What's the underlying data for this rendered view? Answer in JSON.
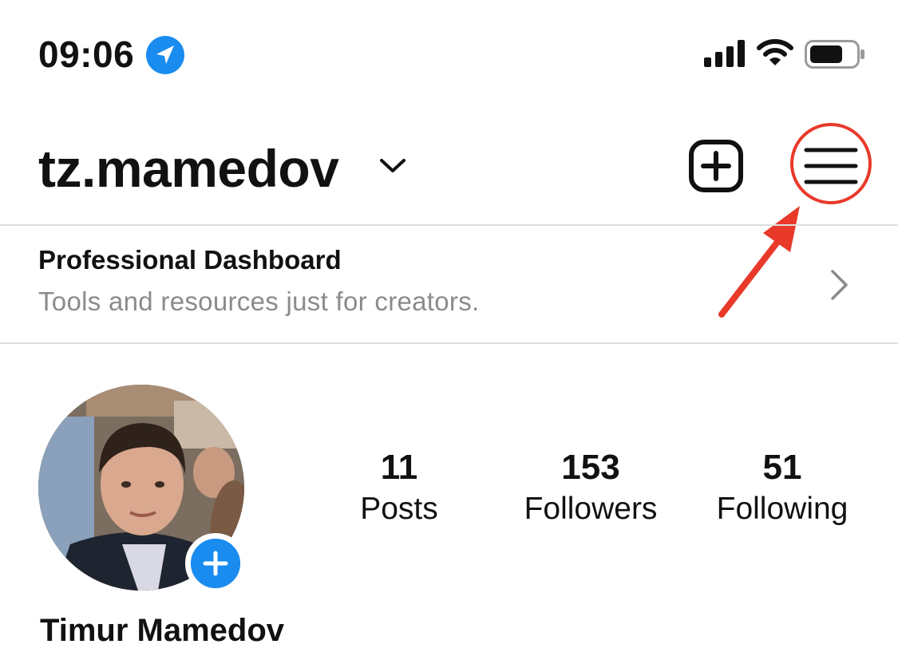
{
  "status_bar": {
    "time": "09:06",
    "icons": [
      "location-arrow-icon",
      "cellular-signal-icon",
      "wifi-icon",
      "battery-icon"
    ],
    "location_color": "#1a8cf0"
  },
  "header": {
    "username": "tz.mamedov",
    "icons": [
      "chevron-down-icon",
      "add-post-icon",
      "hamburger-menu-icon"
    ]
  },
  "annotation": {
    "color": "#e8392a",
    "target": "hamburger-menu-icon"
  },
  "dashboard": {
    "title": "Professional Dashboard",
    "subtitle": "Tools and resources just for creators."
  },
  "profile": {
    "full_name": "Timur Mamedov",
    "story_add_color": "#1a8cf0",
    "stats": [
      {
        "value": "11",
        "label": "Posts"
      },
      {
        "value": "153",
        "label": "Followers"
      },
      {
        "value": "51",
        "label": "Following"
      }
    ]
  }
}
